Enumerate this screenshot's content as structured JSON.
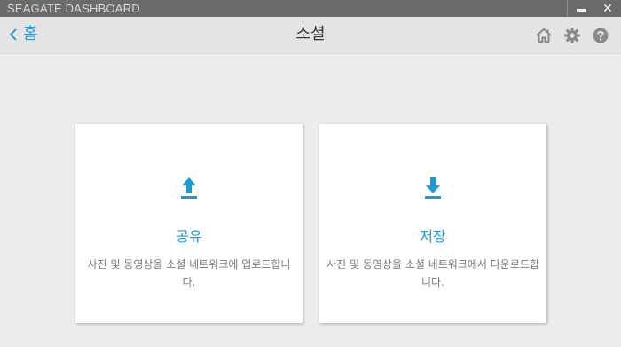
{
  "window": {
    "title": "SEAGATE DASHBOARD",
    "close_label": "✕"
  },
  "header": {
    "back_label": "홈",
    "title": "소셜",
    "icons": [
      "home-icon",
      "gear-icon",
      "help-icon"
    ]
  },
  "cards": {
    "share": {
      "title": "공유",
      "description": "사진 및 동영상을 소셜 네트워크에 업로드합니다.",
      "icon": "upload-icon"
    },
    "store": {
      "title": "저장",
      "description": "사진 및 동영상을 소셜 네트워크에서 다운로드합니다.",
      "icon": "download-icon"
    }
  },
  "colors": {
    "accent": "#1c9ad6",
    "titlebar": "#6b6b6b",
    "header": "#e4e4e4",
    "background": "#ececec",
    "icon_gray": "#8a8a8a"
  }
}
